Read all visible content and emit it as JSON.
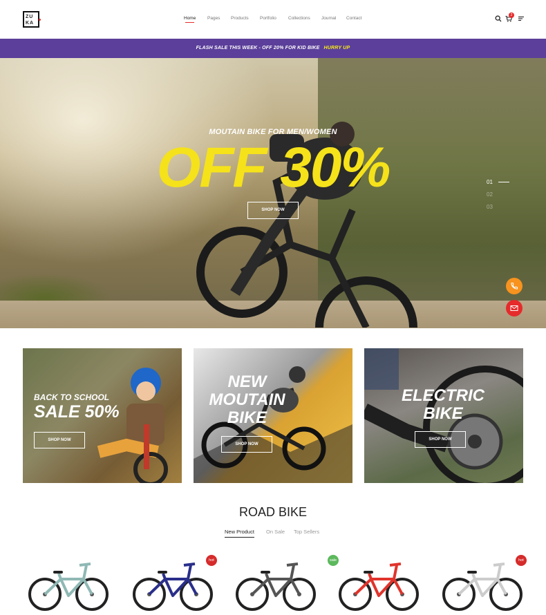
{
  "header": {
    "logo_top": "ZU",
    "logo_bottom": "KA",
    "nav": [
      "Home",
      "Pages",
      "Products",
      "Portfolio",
      "Collections",
      "Journal",
      "Contact"
    ],
    "cart_count": "2",
    "icons": [
      "search-icon",
      "cart-icon",
      "menu-icon"
    ]
  },
  "flash": {
    "text": "FLASH SALE THIS WEEK - OFF 20% FOR KID BIKE",
    "cta": "HURRY UP",
    "bg": "#5b3f9a",
    "accent": "#f6e81b"
  },
  "hero": {
    "kicker": "MOUTAIN BIKE FOR MEN/WOMEN",
    "headline": "OFF 30%",
    "button": "SHOP NOW",
    "slides": [
      "01",
      "02",
      "03"
    ],
    "active_slide": "01",
    "headline_color": "#f5e21a"
  },
  "contact_buttons": [
    {
      "icon": "phone-icon",
      "color": "#f7931e"
    },
    {
      "icon": "mail-icon",
      "color": "#e52b2b"
    }
  ],
  "banners": [
    {
      "line1": "BACK TO SCHOOL",
      "line2": "SALE 50%",
      "button": "SHOP NOW"
    },
    {
      "line1": "NEW",
      "line2": "MOUTAIN",
      "line3": "BIKE",
      "button": "SHOP NOW"
    },
    {
      "line1": "ELECTRIC",
      "line2": "BIKE",
      "button": "SHOP NOW"
    }
  ],
  "products_section": {
    "title": "ROAD BIKE",
    "tabs": [
      "New Product",
      "On Sale",
      "Top Sellers"
    ],
    "active_tab": "New Product",
    "products": [
      {
        "badge": "",
        "frame_color": "#8fb8b4"
      },
      {
        "badge": "hot",
        "frame_color": "#2a2f8a"
      },
      {
        "badge": "",
        "frame_color": "#555555"
      },
      {
        "badge": "sale",
        "frame_color": "#e0342c"
      },
      {
        "badge": "hot",
        "frame_color": "#cccccc"
      }
    ],
    "badge_colors": {
      "hot": "#d62b2b",
      "sale": "#5cb85c"
    }
  }
}
